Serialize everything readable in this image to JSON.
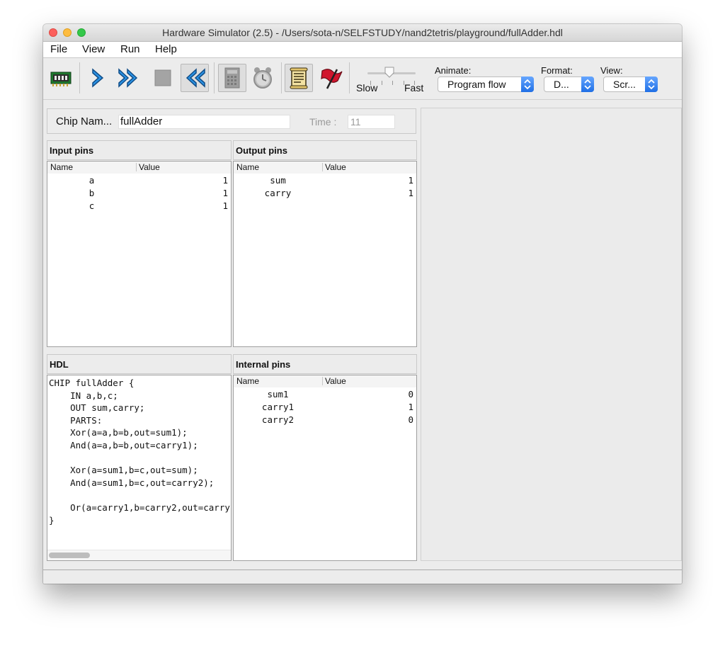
{
  "window": {
    "title": "Hardware Simulator (2.5) - /Users/sota-n/SELFSTUDY/nand2tetris/playground/fullAdder.hdl"
  },
  "menu": [
    "File",
    "View",
    "Run",
    "Help"
  ],
  "toolbar": {
    "icons": [
      "chip-load-icon",
      "single-step-icon",
      "run-icon",
      "stop-icon",
      "reset-icon",
      "calculator-icon",
      "clock-icon",
      "script-icon",
      "breakpoint-flag-icon"
    ],
    "speed": {
      "slow_label": "Slow",
      "fast_label": "Fast",
      "level": 0.45
    },
    "animate": {
      "label": "Animate:",
      "value": "Program flow"
    },
    "format": {
      "label": "Format:",
      "value": "D..."
    },
    "view": {
      "label": "View:",
      "value": "Scr..."
    },
    "accent_color": "#1f6fe5"
  },
  "chip": {
    "name_label": "Chip Nam...",
    "name_value": "fullAdder",
    "time_label": "Time :",
    "time_value": "11"
  },
  "input_pins": {
    "title": "Input pins",
    "col_name": "Name",
    "col_value": "Value",
    "rows": [
      {
        "name": "a",
        "value": "1"
      },
      {
        "name": "b",
        "value": "1"
      },
      {
        "name": "c",
        "value": "1"
      }
    ]
  },
  "output_pins": {
    "title": "Output pins",
    "col_name": "Name",
    "col_value": "Value",
    "rows": [
      {
        "name": "sum",
        "value": "1"
      },
      {
        "name": "carry",
        "value": "1"
      }
    ]
  },
  "hdl": {
    "title": "HDL",
    "code": "CHIP fullAdder {\n    IN a,b,c;\n    OUT sum,carry;\n    PARTS:\n    Xor(a=a,b=b,out=sum1);\n    And(a=a,b=b,out=carry1);\n\n    Xor(a=sum1,b=c,out=sum);\n    And(a=sum1,b=c,out=carry2);\n\n    Or(a=carry1,b=carry2,out=carry\n}"
  },
  "internal_pins": {
    "title": "Internal pins",
    "col_name": "Name",
    "col_value": "Value",
    "rows": [
      {
        "name": "sum1",
        "value": "0"
      },
      {
        "name": "carry1",
        "value": "1"
      },
      {
        "name": "carry2",
        "value": "0"
      }
    ]
  }
}
